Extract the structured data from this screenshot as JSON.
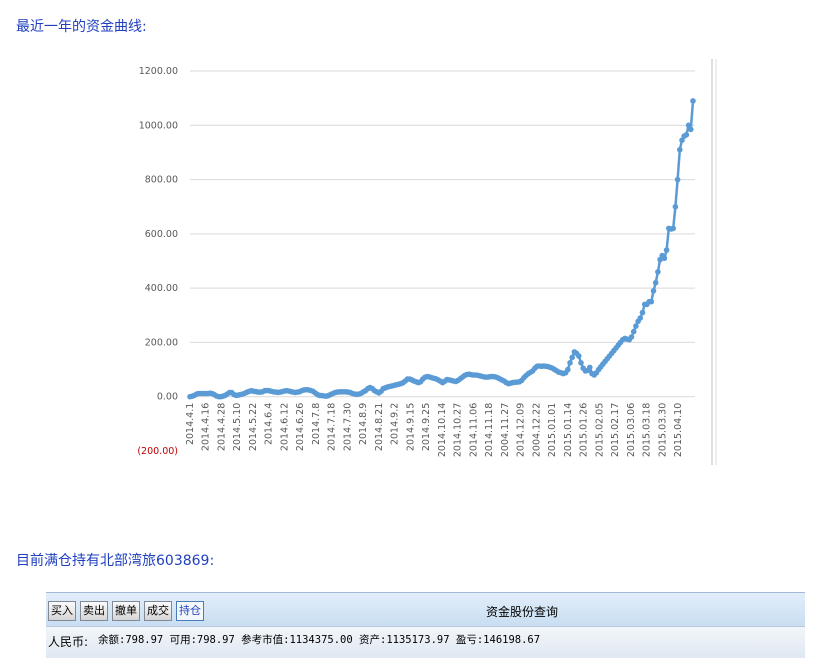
{
  "headings": {
    "chart_heading": "最近一年的资金曲线:",
    "holding_heading": "目前满仓持有北部湾旅603869:"
  },
  "colors": {
    "heading": "#1f3fbf",
    "line": "#5b9bd5",
    "grid": "#d9d9d9",
    "negative_label": "#c00000"
  },
  "chart_data": {
    "type": "line",
    "title": "",
    "xlabel": "",
    "ylabel": "",
    "ylim": [
      -200,
      1200
    ],
    "y_ticks": [
      "(200.00)",
      "0.00",
      "200.00",
      "400.00",
      "600.00",
      "800.00",
      "1000.00",
      "1200.00"
    ],
    "y_tick_values": [
      -200,
      0,
      200,
      400,
      600,
      800,
      1000,
      1200
    ],
    "grid": true,
    "legend": "none",
    "x_tick_labels": [
      "2014.4.1",
      "2014.4.16",
      "2014.4.28",
      "2014.5.10",
      "2014.5.22",
      "2014.6.4",
      "2014.6.12",
      "2014.6.26",
      "2014.7.8",
      "2014.7.18",
      "2014.7.30",
      "2014.8.9",
      "2014.8.21",
      "2014.9.2",
      "2014.9.15",
      "2014.9.25",
      "2014.10.14",
      "2014.10.27",
      "2014.11.06",
      "2014.11.18",
      "2004.11.27",
      "2014.12.09",
      "2004.12.22",
      "2015.01.01",
      "2015.01.14",
      "2015.01.26",
      "2015.02.05",
      "2015.02.17",
      "2015.03.06",
      "2015.03.18",
      "2015.03.30",
      "2015.04.10"
    ],
    "series": [
      {
        "values": [
          0,
          2,
          5,
          10,
          12,
          12,
          12,
          12,
          12,
          13,
          12,
          8,
          3,
          0,
          0,
          2,
          5,
          10,
          15,
          15,
          8,
          5,
          6,
          8,
          10,
          13,
          17,
          20,
          22,
          20,
          19,
          17,
          17,
          18,
          22,
          23,
          22,
          20,
          18,
          17,
          16,
          17,
          19,
          21,
          22,
          21,
          19,
          17,
          16,
          17,
          19,
          23,
          25,
          26,
          25,
          23,
          20,
          14,
          8,
          5,
          4,
          3,
          2,
          4,
          8,
          12,
          15,
          17,
          18,
          18,
          18,
          18,
          17,
          15,
          12,
          10,
          9,
          10,
          13,
          18,
          23,
          30,
          34,
          30,
          22,
          18,
          14,
          20,
          30,
          33,
          36,
          38,
          40,
          42,
          44,
          46,
          48,
          52,
          58,
          65,
          65,
          62,
          58,
          55,
          52,
          55,
          65,
          72,
          74,
          73,
          70,
          68,
          66,
          62,
          57,
          52,
          57,
          63,
          62,
          60,
          58,
          56,
          60,
          66,
          72,
          78,
          82,
          83,
          81,
          80,
          80,
          79,
          77,
          75,
          73,
          72,
          73,
          74,
          74,
          73,
          70,
          66,
          62,
          58,
          52,
          48,
          50,
          52,
          53,
          54,
          55,
          60,
          70,
          78,
          85,
          90,
          95,
          105,
          112,
          113,
          112,
          113,
          112,
          111,
          108,
          105,
          100,
          95,
          90,
          88,
          85,
          88,
          100,
          125,
          145,
          165,
          160,
          150,
          125,
          105,
          95,
          97,
          108,
          85,
          80,
          88,
          100,
          110,
          120,
          130,
          140,
          150,
          160,
          170,
          180,
          190,
          200,
          210,
          215,
          212,
          210,
          220,
          240,
          260,
          278,
          290,
          310,
          340,
          340,
          350,
          350,
          390,
          420,
          460,
          505,
          520,
          510,
          540,
          620,
          618,
          620,
          700,
          800,
          910,
          945,
          960,
          965,
          1000,
          985,
          1090
        ]
      }
    ]
  },
  "panel": {
    "buttons": [
      "买入",
      "卖出",
      "撤单",
      "成交",
      "持仓"
    ],
    "title": "资金股份查询",
    "status_label": "人民币:",
    "status_text": "余额:798.97  可用:798.97  参考市值:1134375.00  资产:1135173.97  盈亏:146198.67"
  }
}
